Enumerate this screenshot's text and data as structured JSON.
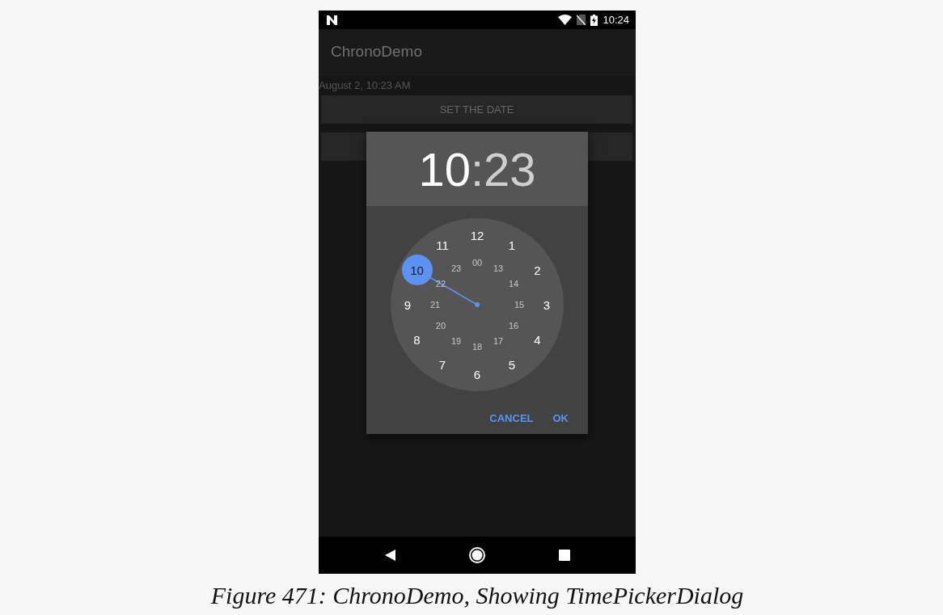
{
  "status_bar": {
    "time": "10:24"
  },
  "app_bar": {
    "title": "ChronoDemo"
  },
  "date_text": "August 2, 10:23 AM",
  "buttons": [
    {
      "label": "SET THE DATE"
    }
  ],
  "dialog": {
    "header": [
      {
        "text": "10",
        "selected": true
      },
      {
        "text": ":",
        "selected": false
      },
      {
        "text": "23",
        "selected": false
      }
    ],
    "outer_numbers": [
      {
        "label": "12",
        "selected": false
      },
      {
        "label": "1",
        "selected": false
      },
      {
        "label": "2",
        "selected": false
      },
      {
        "label": "3",
        "selected": false
      },
      {
        "label": "4",
        "selected": false
      },
      {
        "label": "5",
        "selected": false
      },
      {
        "label": "6",
        "selected": false
      },
      {
        "label": "7",
        "selected": false
      },
      {
        "label": "8",
        "selected": false
      },
      {
        "label": "9",
        "selected": false
      },
      {
        "label": "10",
        "selected": true
      },
      {
        "label": "11",
        "selected": false
      }
    ],
    "inner_numbers": [
      {
        "label": "00"
      },
      {
        "label": "13"
      },
      {
        "label": "14"
      },
      {
        "label": "15"
      },
      {
        "label": "16"
      },
      {
        "label": "17"
      },
      {
        "label": "18"
      },
      {
        "label": "19"
      },
      {
        "label": "20"
      },
      {
        "label": "21"
      },
      {
        "label": "22"
      },
      {
        "label": "23"
      }
    ],
    "actions": [
      "CANCEL",
      "OK"
    ]
  },
  "caption": "Figure 471: ChronoDemo, Showing TimePickerDialog"
}
